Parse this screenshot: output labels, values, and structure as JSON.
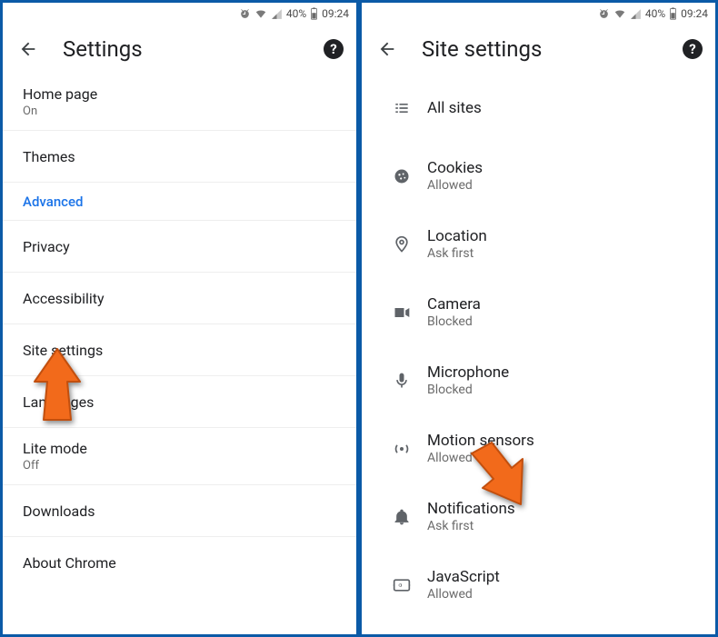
{
  "status": {
    "battery_pct": "40%",
    "time": "09:24"
  },
  "left": {
    "title": "Settings",
    "rows": [
      {
        "label": "Home page",
        "sub": "On",
        "type": "double"
      },
      {
        "label": "Themes",
        "type": "single"
      }
    ],
    "section": "Advanced",
    "rows2": [
      {
        "label": "Privacy",
        "type": "single"
      },
      {
        "label": "Accessibility",
        "type": "single"
      },
      {
        "label": "Site settings",
        "type": "single"
      },
      {
        "label": "Languages",
        "type": "single"
      },
      {
        "label": "Lite mode",
        "sub": "Off",
        "type": "double"
      },
      {
        "label": "Downloads",
        "type": "single"
      },
      {
        "label": "About Chrome",
        "type": "single"
      }
    ]
  },
  "right": {
    "title": "Site settings",
    "items": [
      {
        "icon": "list",
        "label": "All sites"
      },
      {
        "icon": "cookie",
        "label": "Cookies",
        "sub": "Allowed"
      },
      {
        "icon": "location",
        "label": "Location",
        "sub": "Ask first"
      },
      {
        "icon": "camera",
        "label": "Camera",
        "sub": "Blocked"
      },
      {
        "icon": "mic",
        "label": "Microphone",
        "sub": "Blocked"
      },
      {
        "icon": "sensor",
        "label": "Motion sensors",
        "sub": "Allowed"
      },
      {
        "icon": "bell",
        "label": "Notifications",
        "sub": "Ask first"
      },
      {
        "icon": "javascript",
        "label": "JavaScript",
        "sub": "Allowed"
      }
    ]
  },
  "arrows": {
    "left_target": "Site settings",
    "right_target": "Notifications"
  }
}
